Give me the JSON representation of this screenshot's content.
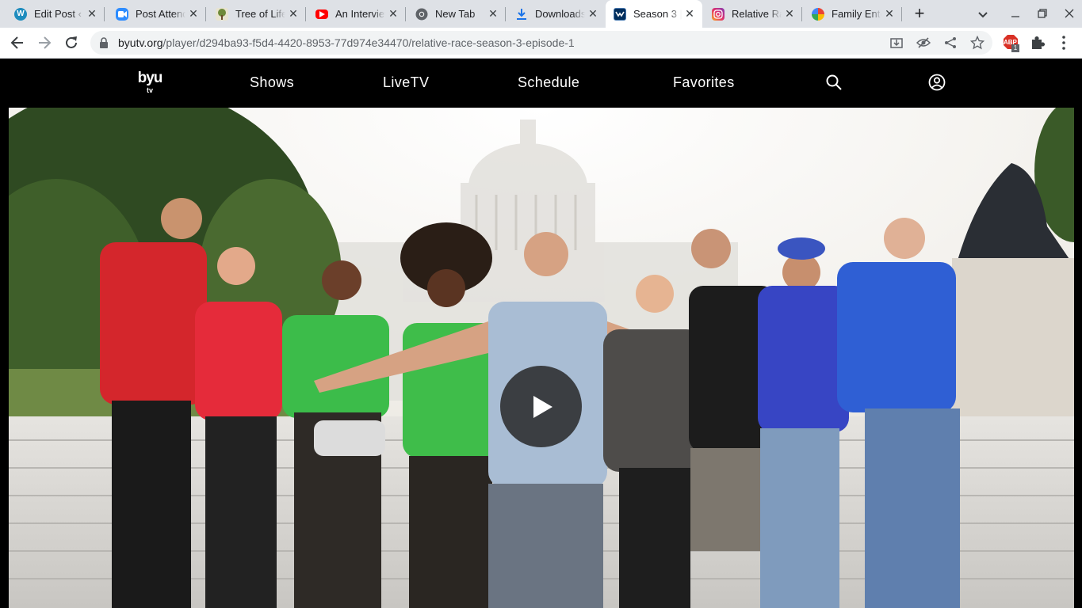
{
  "browser": {
    "tabs": [
      {
        "title": "Edit Post ‹",
        "icon": "wordpress-icon",
        "color": "#1e8cbe"
      },
      {
        "title": "Post Attendees",
        "icon": "zoom-icon",
        "color": "#2d8cff"
      },
      {
        "title": "Tree of Life",
        "icon": "tree-icon",
        "color": "#7a8a3a"
      },
      {
        "title": "An Interview",
        "icon": "youtube-icon",
        "color": "#ff0000"
      },
      {
        "title": "New Tab",
        "icon": "chrome-icon",
        "color": "#5f6368"
      },
      {
        "title": "Downloads",
        "icon": "download-icon",
        "color": "#1a73e8"
      },
      {
        "title": "Season 3 |",
        "icon": "byutv-icon",
        "color": "#002e5d",
        "active": true
      },
      {
        "title": "Relative Race",
        "icon": "instagram-icon",
        "color": "#e1306c"
      },
      {
        "title": "Family Entertainment",
        "icon": "colorwheel-icon",
        "color": "#f4b400"
      }
    ],
    "close_glyph": "✕",
    "new_tab_glyph": "+",
    "url_host": "byutv.org",
    "url_path": "/player/d294ba93-f5d4-4420-8953-77d974e34470/relative-race-season-3-episode-1",
    "extension_badge": "ABP",
    "extension_count": "1"
  },
  "site": {
    "logo_top": "byu",
    "logo_bottom": "tv",
    "nav": {
      "shows": "Shows",
      "livetv": "LiveTV",
      "schedule": "Schedule",
      "favorites": "Favorites"
    }
  },
  "player": {
    "state": "paused",
    "play_icon": "play-icon",
    "brand_color": "#002e5d"
  }
}
